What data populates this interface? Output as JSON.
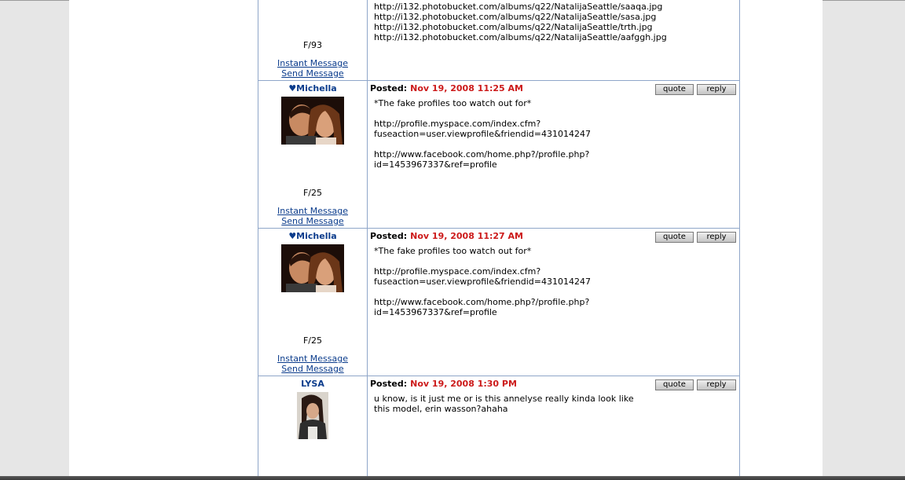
{
  "post0": {
    "demographic": "F/93",
    "instant_message": "Instant Message",
    "send_message": "Send Message",
    "body": "http://i132.photobucket.com/albums/q22/NatalijaSeattle/saaqa.jpg\nhttp://i132.photobucket.com/albums/q22/NatalijaSeattle/sasa.jpg\nhttp://i132.photobucket.com/albums/q22/NatalijaSeattle/trth.jpg\nhttp://i132.photobucket.com/albums/q22/NatalijaSeattle/aafggh.jpg"
  },
  "post1": {
    "username": "♥Michella",
    "posted_label": "Posted:",
    "date": "Nov 19, 2008 11:25 AM",
    "quote": "quote",
    "reply": "reply",
    "demographic": "F/25",
    "instant_message": "Instant Message",
    "send_message": "Send Message",
    "body": "*The fake profiles too watch out for*\n\nhttp://profile.myspace.com/index.cfm?\nfuseaction=user.viewprofile&friendid=431014247\n\nhttp://www.facebook.com/home.php?/profile.php?\nid=1453967337&ref=profile"
  },
  "post2": {
    "username": "♥Michella",
    "posted_label": "Posted:",
    "date": "Nov 19, 2008 11:27 AM",
    "quote": "quote",
    "reply": "reply",
    "demographic": "F/25",
    "instant_message": "Instant Message",
    "send_message": "Send Message",
    "body": "*The fake profiles too watch out for*\n\nhttp://profile.myspace.com/index.cfm?\nfuseaction=user.viewprofile&friendid=431014247\n\nhttp://www.facebook.com/home.php?/profile.php?\nid=1453967337&ref=profile"
  },
  "post3": {
    "username": "LYSA",
    "posted_label": "Posted:",
    "date": "Nov 19, 2008 1:30 PM",
    "quote": "quote",
    "reply": "reply",
    "body": "u know, is it just me or is this annelyse really kinda look like\nthis model, erin wasson?ahaha"
  },
  "colors": {
    "page_bg": "#e6e6e6",
    "content_bg": "#ffffff",
    "border": "#8fa6c9",
    "username": "#0b3c8c",
    "date": "#cc1a1a"
  }
}
